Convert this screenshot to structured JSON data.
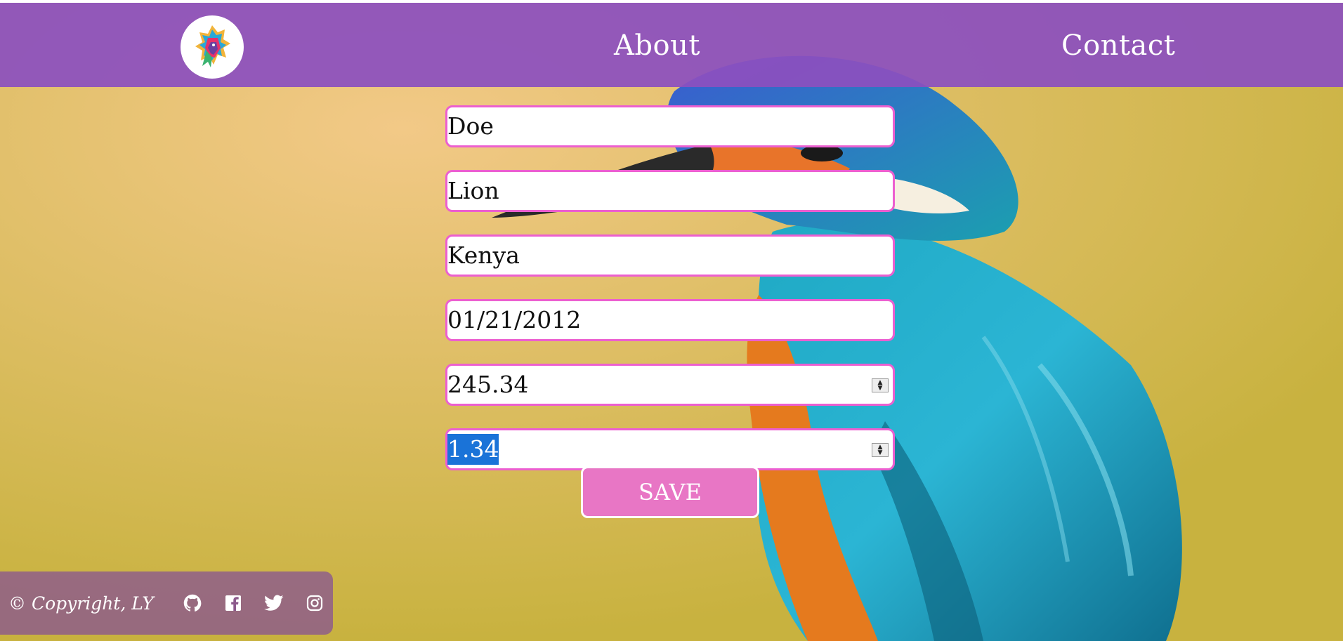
{
  "nav": {
    "about_label": "About",
    "contact_label": "Contact"
  },
  "form": {
    "last_name": "Doe",
    "animal": "Lion",
    "country": "Kenya",
    "date": "01/21/2012",
    "amount": "245.34",
    "rate": "1.34"
  },
  "save_label": "SAVE",
  "footer": {
    "copyright": "© Copyright, LY",
    "icons": [
      "github-icon",
      "facebook-icon",
      "twitter-icon",
      "instagram-icon"
    ]
  },
  "colors": {
    "header_bg": "#8c50be",
    "field_border": "#ec5fd0",
    "button_bg": "#e876c5",
    "footer_bg": "#8c5a8c",
    "selection": "#1a73d8"
  }
}
